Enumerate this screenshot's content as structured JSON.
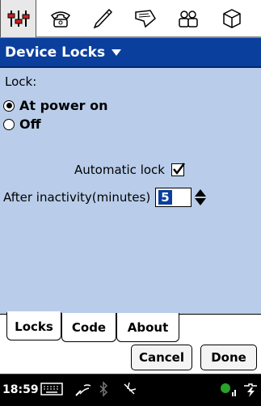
{
  "app_tabs": [
    {
      "icon": "settings-sliders-icon",
      "active": true
    },
    {
      "icon": "phone-icon",
      "active": false
    },
    {
      "icon": "pen-icon",
      "active": false
    },
    {
      "icon": "message-icon",
      "active": false
    },
    {
      "icon": "people-icon",
      "active": false
    },
    {
      "icon": "cube-icon",
      "active": false
    }
  ],
  "header": {
    "title": "Device Locks"
  },
  "lock": {
    "label": "Lock:",
    "options": [
      {
        "label": "At power on",
        "selected": true
      },
      {
        "label": "Off",
        "selected": false
      }
    ]
  },
  "automatic_lock": {
    "label": "Automatic lock",
    "checked": true
  },
  "inactivity": {
    "label": "After inactivity(minutes)",
    "value": "5"
  },
  "tabs": [
    {
      "label": "Locks",
      "active": true
    },
    {
      "label": "Code",
      "active": false
    },
    {
      "label": "About",
      "active": false
    }
  ],
  "buttons": {
    "cancel": "Cancel",
    "done": "Done"
  },
  "status": {
    "time": "18:59"
  },
  "colors": {
    "title_bg": "#0a3f9e",
    "panel_bg": "#b9cdea",
    "status_bg": "#000000"
  }
}
